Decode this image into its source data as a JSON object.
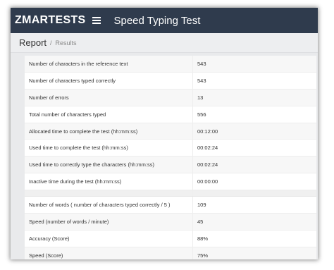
{
  "app": {
    "logo_text": "ZMARTESTS",
    "title": "Speed Typing Test"
  },
  "breadcrumb": {
    "main": "Report",
    "separator": "/",
    "sub": "Results"
  },
  "results": {
    "group1": [
      {
        "label": "Number of characters in the reference text",
        "value": "543"
      },
      {
        "label": "Number of characters typed correctly",
        "value": "543"
      },
      {
        "label": "Number of errors",
        "value": "13"
      },
      {
        "label": "Total number of characters typed",
        "value": "556"
      },
      {
        "label": "Allocated time to complete the test (hh:mm:ss)",
        "value": "00:12:00"
      },
      {
        "label": "Used time to complete the test (hh:mm:ss)",
        "value": "00:02:24"
      },
      {
        "label": "Used time to correctly type the characters (hh:mm:ss)",
        "value": "00:02:24"
      },
      {
        "label": "Inactive time during the test (hh:mm:ss)",
        "value": "00:00:00"
      }
    ],
    "group2": [
      {
        "label": "Number of words ( number of characters typed correctly / 5 )",
        "value": "109"
      },
      {
        "label": "Speed (number of words / minute)",
        "value": "45"
      },
      {
        "label": "Accuracy (Score)",
        "value": "88%"
      },
      {
        "label": "Speed (Score)",
        "value": "75%"
      }
    ]
  },
  "colors": {
    "topbar": "#2f3b4d",
    "logo_accent": "#3b82d6",
    "page_background": "#e9eaec"
  },
  "icons": [
    "hamburger-menu-icon"
  ]
}
